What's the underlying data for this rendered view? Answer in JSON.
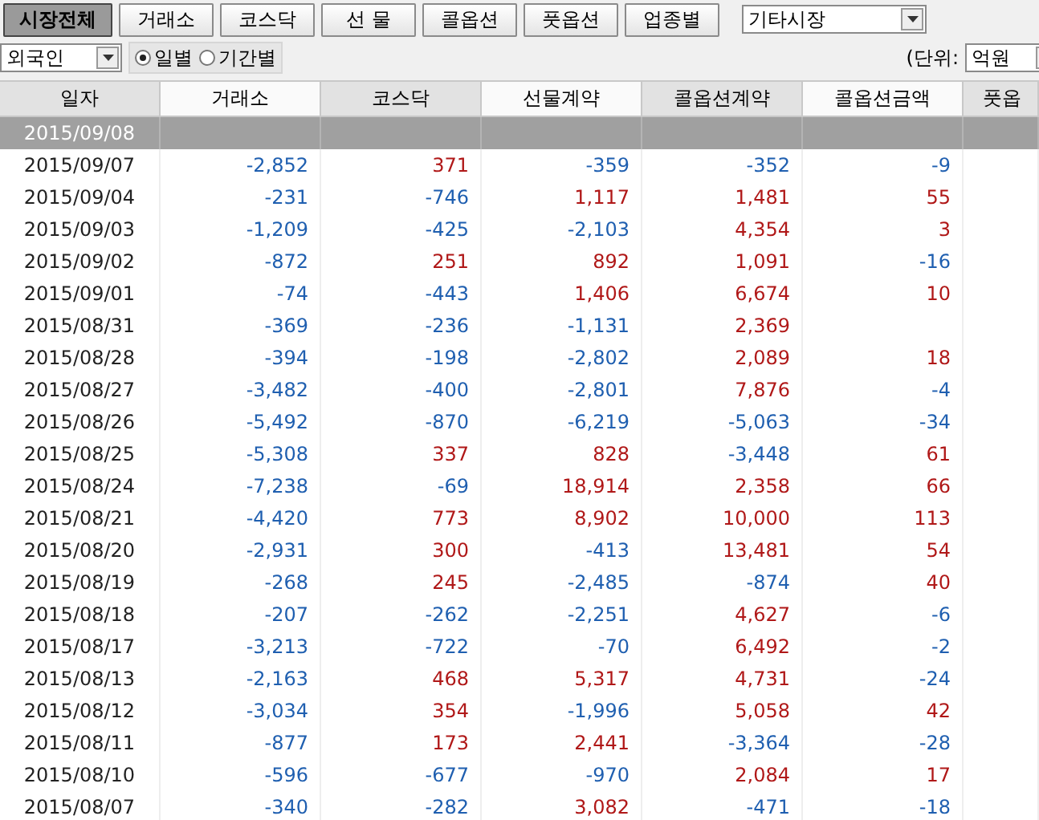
{
  "market_tabs": [
    {
      "label": "시장전체",
      "selected": true
    },
    {
      "label": "거래소",
      "selected": false
    },
    {
      "label": "코스닥",
      "selected": false
    },
    {
      "label": "선 물",
      "selected": false
    },
    {
      "label": "콜옵션",
      "selected": false
    },
    {
      "label": "풋옵션",
      "selected": false
    },
    {
      "label": "업종별",
      "selected": false
    }
  ],
  "market_dropdown": {
    "value": "기타시장"
  },
  "investor_dropdown": {
    "value": "외국인"
  },
  "period_options": [
    {
      "label": "일별",
      "selected": true
    },
    {
      "label": "기간별",
      "selected": false
    }
  ],
  "unit_label": "(단위:",
  "unit_dropdown": {
    "value": "억원"
  },
  "table": {
    "columns": [
      "일자",
      "거래소",
      "코스닥",
      "선물계약",
      "콜옵션계약",
      "콜옵션금액",
      "풋옵"
    ],
    "rows": [
      {
        "selected": true,
        "cells": [
          "2015/09/08",
          "",
          "",
          "",
          "",
          "",
          ""
        ]
      },
      {
        "selected": false,
        "cells": [
          "2015/09/07",
          "-2,852",
          "371",
          "-359",
          "-352",
          "-9",
          ""
        ]
      },
      {
        "selected": false,
        "cells": [
          "2015/09/04",
          "-231",
          "-746",
          "1,117",
          "1,481",
          "55",
          ""
        ]
      },
      {
        "selected": false,
        "cells": [
          "2015/09/03",
          "-1,209",
          "-425",
          "-2,103",
          "4,354",
          "3",
          ""
        ]
      },
      {
        "selected": false,
        "cells": [
          "2015/09/02",
          "-872",
          "251",
          "892",
          "1,091",
          "-16",
          ""
        ]
      },
      {
        "selected": false,
        "cells": [
          "2015/09/01",
          "-74",
          "-443",
          "1,406",
          "6,674",
          "10",
          ""
        ]
      },
      {
        "selected": false,
        "cells": [
          "2015/08/31",
          "-369",
          "-236",
          "-1,131",
          "2,369",
          "",
          ""
        ]
      },
      {
        "selected": false,
        "cells": [
          "2015/08/28",
          "-394",
          "-198",
          "-2,802",
          "2,089",
          "18",
          ""
        ]
      },
      {
        "selected": false,
        "cells": [
          "2015/08/27",
          "-3,482",
          "-400",
          "-2,801",
          "7,876",
          "-4",
          ""
        ]
      },
      {
        "selected": false,
        "cells": [
          "2015/08/26",
          "-5,492",
          "-870",
          "-6,219",
          "-5,063",
          "-34",
          ""
        ]
      },
      {
        "selected": false,
        "cells": [
          "2015/08/25",
          "-5,308",
          "337",
          "828",
          "-3,448",
          "61",
          ""
        ]
      },
      {
        "selected": false,
        "cells": [
          "2015/08/24",
          "-7,238",
          "-69",
          "18,914",
          "2,358",
          "66",
          ""
        ]
      },
      {
        "selected": false,
        "cells": [
          "2015/08/21",
          "-4,420",
          "773",
          "8,902",
          "10,000",
          "113",
          ""
        ]
      },
      {
        "selected": false,
        "cells": [
          "2015/08/20",
          "-2,931",
          "300",
          "-413",
          "13,481",
          "54",
          ""
        ]
      },
      {
        "selected": false,
        "cells": [
          "2015/08/19",
          "-268",
          "245",
          "-2,485",
          "-874",
          "40",
          ""
        ]
      },
      {
        "selected": false,
        "cells": [
          "2015/08/18",
          "-207",
          "-262",
          "-2,251",
          "4,627",
          "-6",
          ""
        ]
      },
      {
        "selected": false,
        "cells": [
          "2015/08/17",
          "-3,213",
          "-722",
          "-70",
          "6,492",
          "-2",
          ""
        ]
      },
      {
        "selected": false,
        "cells": [
          "2015/08/13",
          "-2,163",
          "468",
          "5,317",
          "4,731",
          "-24",
          ""
        ]
      },
      {
        "selected": false,
        "cells": [
          "2015/08/12",
          "-3,034",
          "354",
          "-1,996",
          "5,058",
          "42",
          ""
        ]
      },
      {
        "selected": false,
        "cells": [
          "2015/08/11",
          "-877",
          "173",
          "2,441",
          "-3,364",
          "-28",
          ""
        ]
      },
      {
        "selected": false,
        "cells": [
          "2015/08/10",
          "-596",
          "-677",
          "-970",
          "2,084",
          "17",
          ""
        ]
      },
      {
        "selected": false,
        "cells": [
          "2015/08/07",
          "-340",
          "-282",
          "3,082",
          "-471",
          "-18",
          ""
        ]
      }
    ]
  }
}
